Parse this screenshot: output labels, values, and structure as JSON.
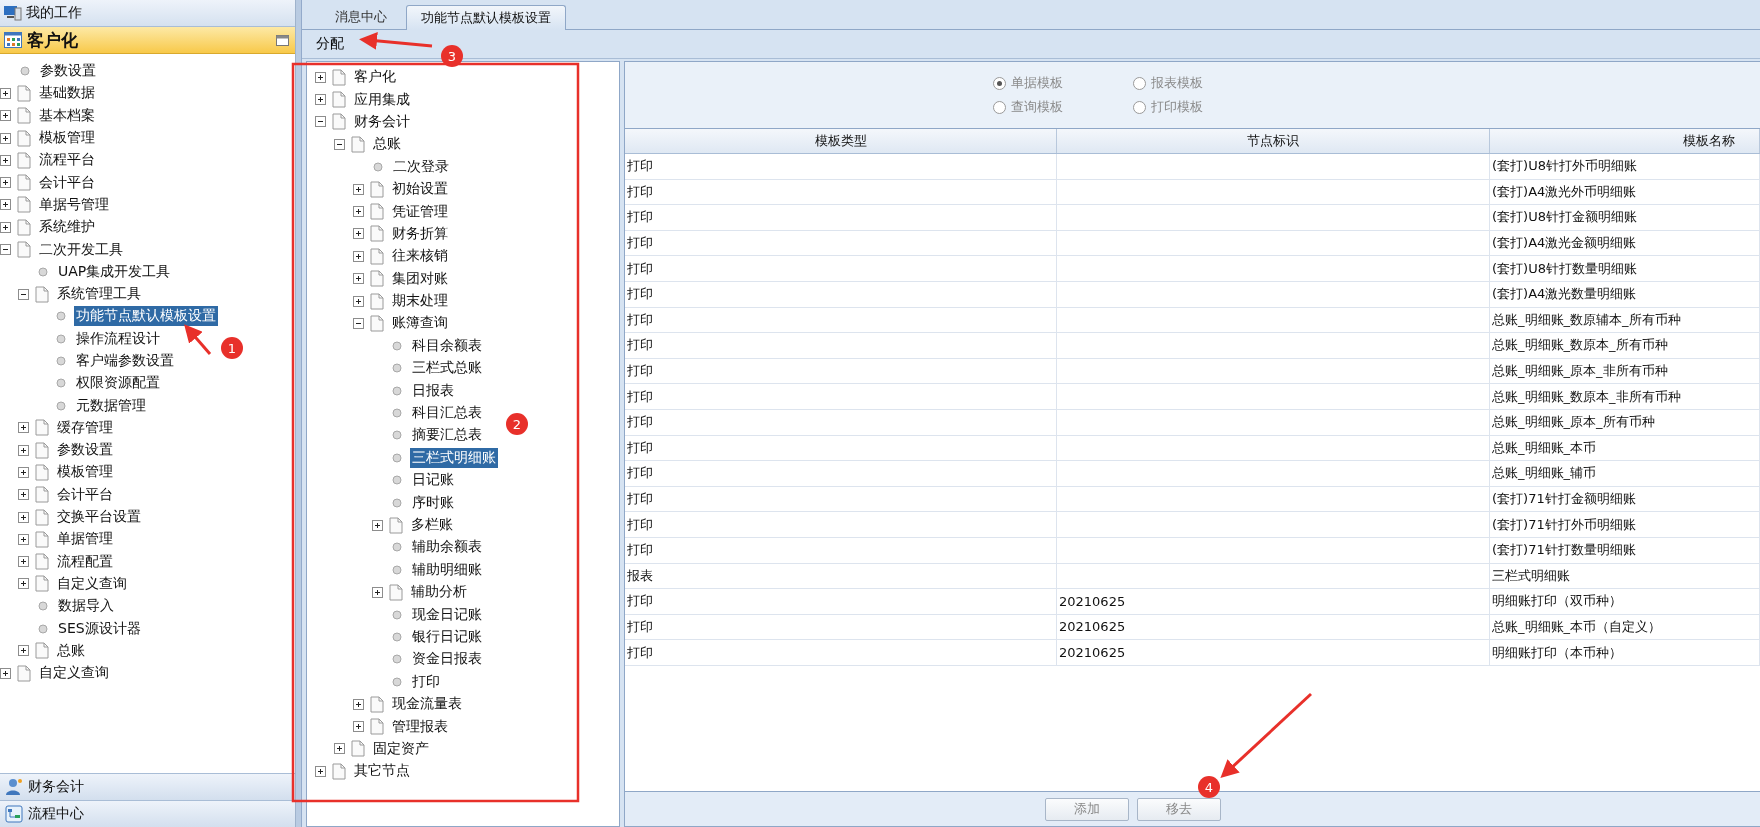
{
  "sidebar": {
    "top_bar": {
      "label": "我的工作"
    },
    "section": {
      "label": "客户化"
    },
    "tree": [
      {
        "label": "参数设置",
        "kind": "leaf",
        "selected": false
      },
      {
        "label": "基础数据",
        "kind": "folder",
        "expanded": false,
        "selected": false
      },
      {
        "label": "基本档案",
        "kind": "folder",
        "expanded": false,
        "selected": false
      },
      {
        "label": "模板管理",
        "kind": "folder",
        "expanded": false,
        "selected": false
      },
      {
        "label": "流程平台",
        "kind": "folder",
        "expanded": false,
        "selected": false
      },
      {
        "label": "会计平台",
        "kind": "folder",
        "expanded": false,
        "selected": false
      },
      {
        "label": "单据号管理",
        "kind": "folder",
        "expanded": false,
        "selected": false
      },
      {
        "label": "系统维护",
        "kind": "folder",
        "expanded": false,
        "selected": false
      },
      {
        "label": "二次开发工具",
        "kind": "folder",
        "expanded": true,
        "selected": false,
        "children": [
          {
            "label": "UAP集成开发工具",
            "kind": "leaf",
            "selected": false
          },
          {
            "label": "系统管理工具",
            "kind": "folder",
            "expanded": true,
            "selected": false,
            "children": [
              {
                "label": "功能节点默认模板设置",
                "kind": "leaf",
                "selected": true
              },
              {
                "label": "操作流程设计",
                "kind": "leaf",
                "selected": false
              },
              {
                "label": "客户端参数设置",
                "kind": "leaf",
                "selected": false
              },
              {
                "label": "权限资源配置",
                "kind": "leaf",
                "selected": false
              },
              {
                "label": "元数据管理",
                "kind": "leaf",
                "selected": false
              }
            ]
          },
          {
            "label": "缓存管理",
            "kind": "folder",
            "expanded": false,
            "selected": false
          },
          {
            "label": "参数设置",
            "kind": "folder",
            "expanded": false,
            "selected": false
          },
          {
            "label": "模板管理",
            "kind": "folder",
            "expanded": false,
            "selected": false
          },
          {
            "label": "会计平台",
            "kind": "folder",
            "expanded": false,
            "selected": false
          },
          {
            "label": "交换平台设置",
            "kind": "folder",
            "expanded": false,
            "selected": false
          },
          {
            "label": "单据管理",
            "kind": "folder",
            "expanded": false,
            "selected": false
          },
          {
            "label": "流程配置",
            "kind": "folder",
            "expanded": false,
            "selected": false
          },
          {
            "label": "自定义查询",
            "kind": "folder",
            "expanded": false,
            "selected": false
          },
          {
            "label": "数据导入",
            "kind": "leaf",
            "selected": false
          },
          {
            "label": "SES源设计器",
            "kind": "leaf",
            "selected": false
          },
          {
            "label": "总账",
            "kind": "folder",
            "expanded": false,
            "selected": false
          }
        ]
      },
      {
        "label": "自定义查询",
        "kind": "folder",
        "expanded": false,
        "selected": false
      }
    ],
    "bottom_bars": [
      {
        "label": "财务会计",
        "kind": "people"
      },
      {
        "label": "流程中心",
        "kind": "flow"
      }
    ]
  },
  "tabs": [
    {
      "label": "消息中心",
      "selected": false
    },
    {
      "label": "功能节点默认模板设置",
      "selected": true
    }
  ],
  "toolbar": {
    "buttons": [
      {
        "label": "分配"
      }
    ]
  },
  "node_tree": [
    {
      "label": "客户化",
      "kind": "folder",
      "expanded": false,
      "selected": false
    },
    {
      "label": "应用集成",
      "kind": "folder",
      "expanded": false,
      "selected": false
    },
    {
      "label": "财务会计",
      "kind": "folder",
      "expanded": true,
      "selected": false,
      "children": [
        {
          "label": "总账",
          "kind": "folder",
          "expanded": true,
          "selected": false,
          "children": [
            {
              "label": "二次登录",
              "kind": "leaf",
              "selected": false
            },
            {
              "label": "初始设置",
              "kind": "folder",
              "expanded": false,
              "selected": false
            },
            {
              "label": "凭证管理",
              "kind": "folder",
              "expanded": false,
              "selected": false
            },
            {
              "label": "财务折算",
              "kind": "folder",
              "expanded": false,
              "selected": false
            },
            {
              "label": "往来核销",
              "kind": "folder",
              "expanded": false,
              "selected": false
            },
            {
              "label": "集团对账",
              "kind": "folder",
              "expanded": false,
              "selected": false
            },
            {
              "label": "期末处理",
              "kind": "folder",
              "expanded": false,
              "selected": false
            },
            {
              "label": "账簿查询",
              "kind": "folder",
              "expanded": true,
              "selected": false,
              "children": [
                {
                  "label": "科目余额表",
                  "kind": "leaf",
                  "selected": false
                },
                {
                  "label": "三栏式总账",
                  "kind": "leaf",
                  "selected": false
                },
                {
                  "label": "日报表",
                  "kind": "leaf",
                  "selected": false
                },
                {
                  "label": "科目汇总表",
                  "kind": "leaf",
                  "selected": false
                },
                {
                  "label": "摘要汇总表",
                  "kind": "leaf",
                  "selected": false
                },
                {
                  "label": "三栏式明细账",
                  "kind": "leaf",
                  "selected": true
                },
                {
                  "label": "日记账",
                  "kind": "leaf",
                  "selected": false
                },
                {
                  "label": "序时账",
                  "kind": "leaf",
                  "selected": false
                },
                {
                  "label": "多栏账",
                  "kind": "folder",
                  "expanded": false,
                  "selected": false
                },
                {
                  "label": "辅助余额表",
                  "kind": "leaf",
                  "selected": false
                },
                {
                  "label": "辅助明细账",
                  "kind": "leaf",
                  "selected": false
                },
                {
                  "label": "辅助分析",
                  "kind": "folder",
                  "expanded": false,
                  "selected": false
                },
                {
                  "label": "现金日记账",
                  "kind": "leaf",
                  "selected": false
                },
                {
                  "label": "银行日记账",
                  "kind": "leaf",
                  "selected": false
                },
                {
                  "label": "资金日报表",
                  "kind": "leaf",
                  "selected": false
                },
                {
                  "label": "打印",
                  "kind": "leaf",
                  "selected": false
                }
              ]
            },
            {
              "label": "现金流量表",
              "kind": "folder",
              "expanded": false,
              "selected": false
            },
            {
              "label": "管理报表",
              "kind": "folder",
              "expanded": false,
              "selected": false
            }
          ]
        },
        {
          "label": "固定资产",
          "kind": "folder",
          "expanded": false,
          "selected": false
        }
      ]
    },
    {
      "label": "其它节点",
      "kind": "folder",
      "expanded": false,
      "selected": false
    }
  ],
  "template_radios": {
    "disabled": true,
    "options": [
      {
        "label": "单据模板",
        "selected": true
      },
      {
        "label": "报表模板",
        "selected": false
      },
      {
        "label": "查询模板",
        "selected": false
      },
      {
        "label": "打印模板",
        "selected": false
      }
    ]
  },
  "table": {
    "columns": [
      "模板类型",
      "节点标识",
      "模板名称"
    ],
    "rows": [
      {
        "template_type": "打印",
        "template_name": "(套打)U8针打外币明细账"
      },
      {
        "template_type": "打印",
        "template_name": "(套打)A4激光外币明细账"
      },
      {
        "template_type": "打印",
        "template_name": "(套打)U8针打金额明细账"
      },
      {
        "template_type": "打印",
        "template_name": "(套打)A4激光金额明细账"
      },
      {
        "template_type": "打印",
        "template_name": "(套打)U8针打数量明细账"
      },
      {
        "template_type": "打印",
        "template_name": "(套打)A4激光数量明细账"
      },
      {
        "template_type": "打印",
        "template_name": "总账_明细账_数原辅本_所有币种"
      },
      {
        "template_type": "打印",
        "template_name": "总账_明细账_数原本_所有币种"
      },
      {
        "template_type": "打印",
        "template_name": "总账_明细账_原本_非所有币种"
      },
      {
        "template_type": "打印",
        "template_name": "总账_明细账_数原本_非所有币种"
      },
      {
        "template_type": "打印",
        "template_name": "总账_明细账_原本_所有币种"
      },
      {
        "template_type": "打印",
        "template_name": "总账_明细账_本币"
      },
      {
        "template_type": "打印",
        "template_name": "总账_明细账_辅币"
      },
      {
        "template_type": "打印",
        "template_name": "(套打)71针打金额明细账"
      },
      {
        "template_type": "打印",
        "template_name": "(套打)71针打外币明细账"
      },
      {
        "template_type": "打印",
        "template_name": "(套打)71针打数量明细账"
      },
      {
        "template_type": "报表",
        "template_name": "三栏式明细账"
      },
      {
        "template_type": "打印",
        "node_id": "20210625",
        "template_name": "明细账打印（双币种）"
      },
      {
        "template_type": "打印",
        "node_id": "20210625",
        "template_name": "总账_明细账_本币（自定义）"
      },
      {
        "template_type": "打印",
        "node_id": "20210625",
        "template_name": "明细账打印（本币种）"
      }
    ]
  },
  "action_buttons": {
    "disabled": true,
    "items": [
      {
        "label": "添加"
      },
      {
        "label": "移去"
      }
    ]
  },
  "annotations": {
    "badges": [
      {
        "label": "1"
      },
      {
        "label": "2"
      },
      {
        "label": "3"
      },
      {
        "label": "4"
      }
    ]
  }
}
